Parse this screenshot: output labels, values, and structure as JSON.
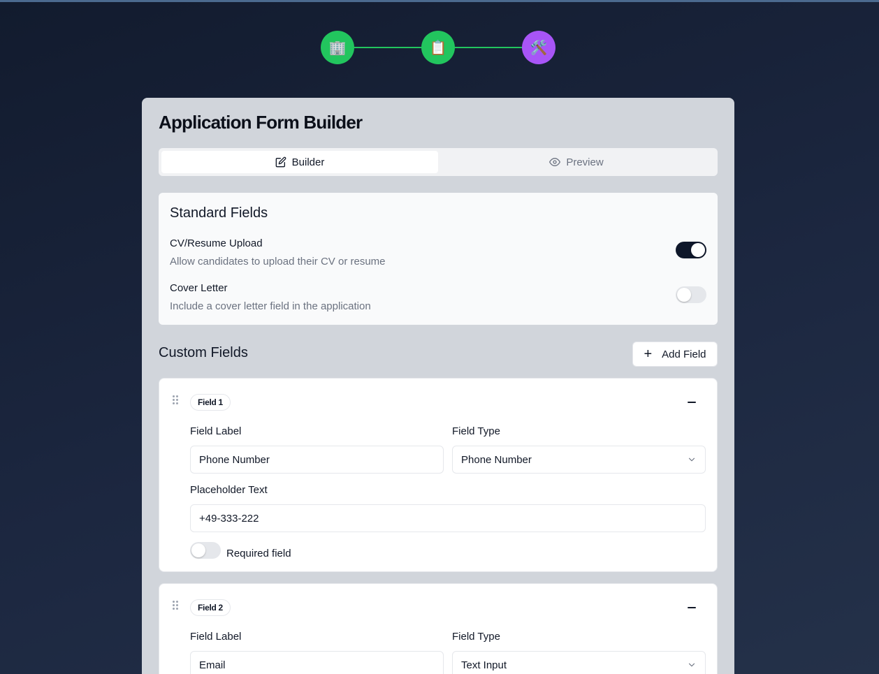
{
  "stepper": {
    "steps": [
      {
        "icon": "🏢",
        "name": "building-icon"
      },
      {
        "icon": "📋",
        "name": "clipboard-icon"
      },
      {
        "icon": "🛠️",
        "name": "tools-icon"
      }
    ],
    "colors": {
      "complete": "#22c55e",
      "current": "#a855f7"
    }
  },
  "page": {
    "title": "Application Form Builder"
  },
  "tabs": {
    "builder": "Builder",
    "preview": "Preview"
  },
  "standard_fields": {
    "title": "Standard Fields",
    "items": [
      {
        "label": "CV/Resume Upload",
        "description": "Allow candidates to upload their CV or resume",
        "enabled": true
      },
      {
        "label": "Cover Letter",
        "description": "Include a cover letter field in the application",
        "enabled": false
      }
    ]
  },
  "custom_fields": {
    "title": "Custom Fields",
    "add_label": "Add Field",
    "fields": [
      {
        "badge": "Field 1",
        "label_caption": "Field Label",
        "label_value": "Phone Number",
        "type_caption": "Field Type",
        "type_value": "Phone Number",
        "placeholder_caption": "Placeholder Text",
        "placeholder_value": "+49-333-222",
        "required_label": "Required field",
        "required": false
      },
      {
        "badge": "Field 2",
        "label_caption": "Field Label",
        "label_value": "Email",
        "type_caption": "Field Type",
        "type_value": "Text Input"
      }
    ]
  }
}
